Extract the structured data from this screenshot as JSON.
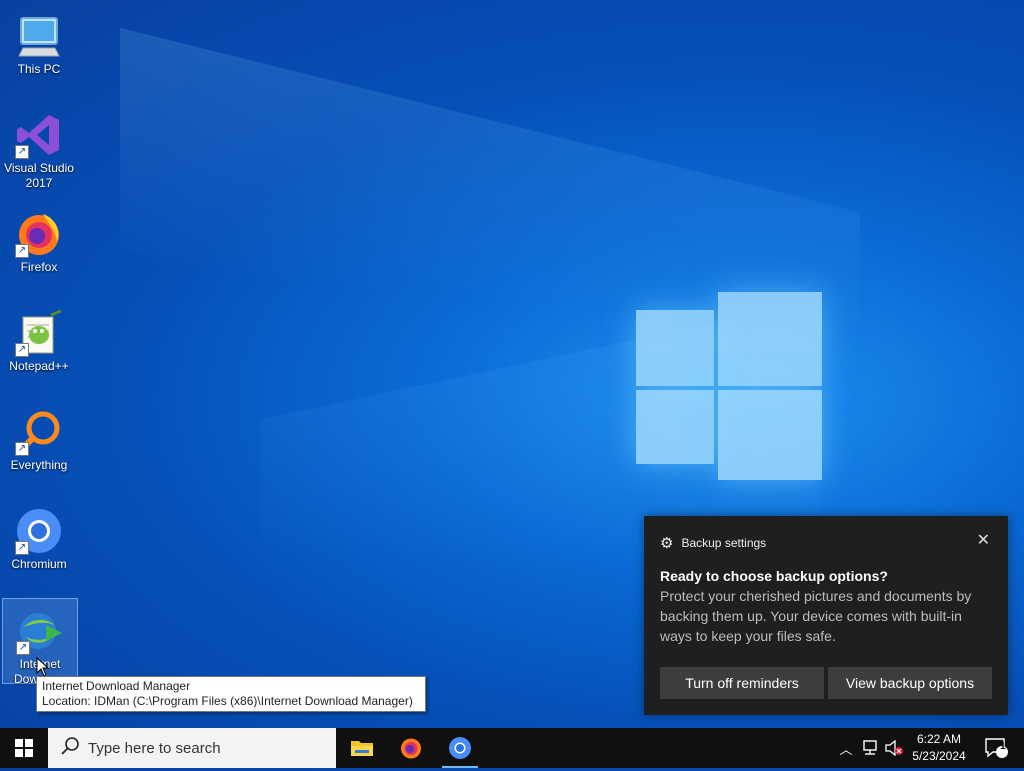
{
  "desktop": {
    "icons": [
      {
        "label": "This PC",
        "icon": "this-pc-icon"
      },
      {
        "label": "Visual Studio 2017",
        "icon": "visual-studio-icon"
      },
      {
        "label": "Firefox",
        "icon": "firefox-icon"
      },
      {
        "label": "Notepad++",
        "icon": "notepadpp-icon"
      },
      {
        "label": "Everything",
        "icon": "everything-search-icon"
      },
      {
        "label": "Chromium",
        "icon": "chromium-icon"
      },
      {
        "label": "Internet Download Manager",
        "label_visible": "Internet Downlo…",
        "icon": "internet-download-manager-icon"
      }
    ]
  },
  "tooltip": {
    "line1": "Internet Download Manager",
    "line2": "Location: IDMan (C:\\Program Files (x86)\\Internet Download Manager)"
  },
  "toast": {
    "app_name": "Backup settings",
    "title": "Ready to choose backup options?",
    "body": "Protect your cherished pictures and documents by backing them up. Your device comes with built-in ways to keep your files safe.",
    "button_secondary": "Turn off reminders",
    "button_primary": "View backup options"
  },
  "taskbar": {
    "search_placeholder": "Type here to search",
    "pinned": [
      "file-explorer-icon",
      "firefox-icon",
      "chromium-icon"
    ],
    "time": "6:22 AM",
    "date": "5/23/2024",
    "notification_count": "1"
  },
  "colors": {
    "wallpaper_base": "#0a6bd6",
    "taskbar": "#101010",
    "toast_bg": "#1f1f1f",
    "toast_button": "#3d3d3d"
  }
}
